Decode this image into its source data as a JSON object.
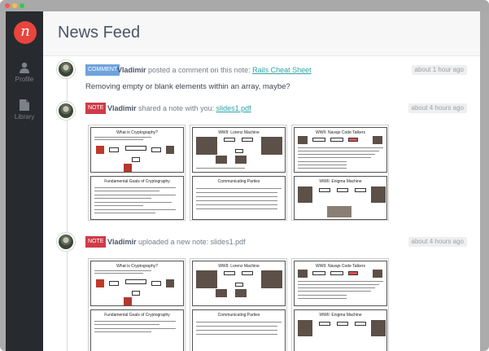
{
  "page": {
    "title": "News Feed"
  },
  "sidebar": {
    "logo_letter": "n",
    "items": [
      {
        "label": "Profile",
        "icon": "person-icon"
      },
      {
        "label": "Library",
        "icon": "document-icon"
      }
    ]
  },
  "feed": [
    {
      "badge": "COMMENT",
      "user": "Vladimir",
      "action": " posted a comment on this note: ",
      "link": "Rails Cheat Sheet",
      "time": "about 1 hour ago",
      "comment": "Removing empty or blank elements within an array, maybe?"
    },
    {
      "badge": "NOTE",
      "user": "Vladimir",
      "action": " shared a note with you: ",
      "link": "slides1.pdf",
      "time": "about 4 hours ago",
      "thumbnails": [
        {
          "top_title": "What is Cryptography?",
          "bottom_title": "Fundamental Goals of Cryptography"
        },
        {
          "top_title": "WWII: Lorenz Machine",
          "bottom_title": "Communicating Parties"
        },
        {
          "top_title": "WWII: Navajo Code Talkers",
          "bottom_title": "WWII: Enigma Machine"
        }
      ]
    },
    {
      "badge": "NOTE",
      "user": "Vladimir",
      "action": " uploaded a new note: slides1.pdf",
      "time": "about 4 hours ago",
      "thumbnails": [
        {
          "top_title": "What is Cryptography?",
          "bottom_title": "Fundamental Goals of Cryptography"
        },
        {
          "top_title": "WWII: Lorenz Machine",
          "bottom_title": "Communicating Parties"
        },
        {
          "top_title": "WWII: Navajo Code Talkers",
          "bottom_title": "WWII: Enigma Machine"
        }
      ]
    }
  ],
  "colors": {
    "accent": "#e8453c",
    "link": "#2aa3a5",
    "comment_badge": "#6fa3dc",
    "note_badge": "#cf3b48",
    "sidebar": "#272a2e"
  }
}
